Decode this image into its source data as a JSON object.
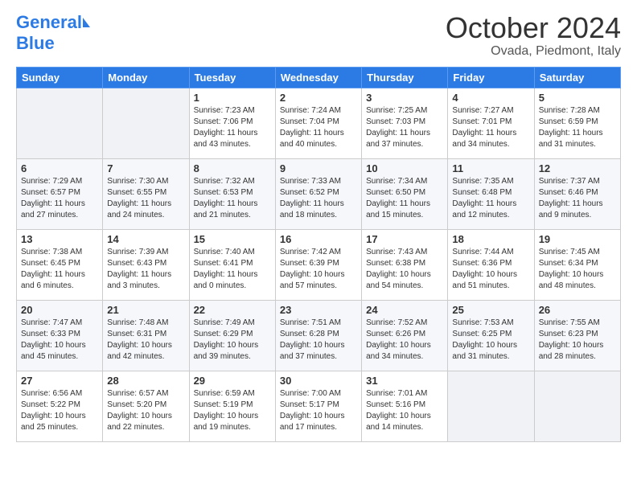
{
  "header": {
    "logo_line1": "General",
    "logo_line2": "Blue",
    "month": "October 2024",
    "location": "Ovada, Piedmont, Italy"
  },
  "days_of_week": [
    "Sunday",
    "Monday",
    "Tuesday",
    "Wednesday",
    "Thursday",
    "Friday",
    "Saturday"
  ],
  "weeks": [
    [
      {
        "day": "",
        "info": ""
      },
      {
        "day": "",
        "info": ""
      },
      {
        "day": "1",
        "info": "Sunrise: 7:23 AM\nSunset: 7:06 PM\nDaylight: 11 hours\nand 43 minutes."
      },
      {
        "day": "2",
        "info": "Sunrise: 7:24 AM\nSunset: 7:04 PM\nDaylight: 11 hours\nand 40 minutes."
      },
      {
        "day": "3",
        "info": "Sunrise: 7:25 AM\nSunset: 7:03 PM\nDaylight: 11 hours\nand 37 minutes."
      },
      {
        "day": "4",
        "info": "Sunrise: 7:27 AM\nSunset: 7:01 PM\nDaylight: 11 hours\nand 34 minutes."
      },
      {
        "day": "5",
        "info": "Sunrise: 7:28 AM\nSunset: 6:59 PM\nDaylight: 11 hours\nand 31 minutes."
      }
    ],
    [
      {
        "day": "6",
        "info": "Sunrise: 7:29 AM\nSunset: 6:57 PM\nDaylight: 11 hours\nand 27 minutes."
      },
      {
        "day": "7",
        "info": "Sunrise: 7:30 AM\nSunset: 6:55 PM\nDaylight: 11 hours\nand 24 minutes."
      },
      {
        "day": "8",
        "info": "Sunrise: 7:32 AM\nSunset: 6:53 PM\nDaylight: 11 hours\nand 21 minutes."
      },
      {
        "day": "9",
        "info": "Sunrise: 7:33 AM\nSunset: 6:52 PM\nDaylight: 11 hours\nand 18 minutes."
      },
      {
        "day": "10",
        "info": "Sunrise: 7:34 AM\nSunset: 6:50 PM\nDaylight: 11 hours\nand 15 minutes."
      },
      {
        "day": "11",
        "info": "Sunrise: 7:35 AM\nSunset: 6:48 PM\nDaylight: 11 hours\nand 12 minutes."
      },
      {
        "day": "12",
        "info": "Sunrise: 7:37 AM\nSunset: 6:46 PM\nDaylight: 11 hours\nand 9 minutes."
      }
    ],
    [
      {
        "day": "13",
        "info": "Sunrise: 7:38 AM\nSunset: 6:45 PM\nDaylight: 11 hours\nand 6 minutes."
      },
      {
        "day": "14",
        "info": "Sunrise: 7:39 AM\nSunset: 6:43 PM\nDaylight: 11 hours\nand 3 minutes."
      },
      {
        "day": "15",
        "info": "Sunrise: 7:40 AM\nSunset: 6:41 PM\nDaylight: 11 hours\nand 0 minutes."
      },
      {
        "day": "16",
        "info": "Sunrise: 7:42 AM\nSunset: 6:39 PM\nDaylight: 10 hours\nand 57 minutes."
      },
      {
        "day": "17",
        "info": "Sunrise: 7:43 AM\nSunset: 6:38 PM\nDaylight: 10 hours\nand 54 minutes."
      },
      {
        "day": "18",
        "info": "Sunrise: 7:44 AM\nSunset: 6:36 PM\nDaylight: 10 hours\nand 51 minutes."
      },
      {
        "day": "19",
        "info": "Sunrise: 7:45 AM\nSunset: 6:34 PM\nDaylight: 10 hours\nand 48 minutes."
      }
    ],
    [
      {
        "day": "20",
        "info": "Sunrise: 7:47 AM\nSunset: 6:33 PM\nDaylight: 10 hours\nand 45 minutes."
      },
      {
        "day": "21",
        "info": "Sunrise: 7:48 AM\nSunset: 6:31 PM\nDaylight: 10 hours\nand 42 minutes."
      },
      {
        "day": "22",
        "info": "Sunrise: 7:49 AM\nSunset: 6:29 PM\nDaylight: 10 hours\nand 39 minutes."
      },
      {
        "day": "23",
        "info": "Sunrise: 7:51 AM\nSunset: 6:28 PM\nDaylight: 10 hours\nand 37 minutes."
      },
      {
        "day": "24",
        "info": "Sunrise: 7:52 AM\nSunset: 6:26 PM\nDaylight: 10 hours\nand 34 minutes."
      },
      {
        "day": "25",
        "info": "Sunrise: 7:53 AM\nSunset: 6:25 PM\nDaylight: 10 hours\nand 31 minutes."
      },
      {
        "day": "26",
        "info": "Sunrise: 7:55 AM\nSunset: 6:23 PM\nDaylight: 10 hours\nand 28 minutes."
      }
    ],
    [
      {
        "day": "27",
        "info": "Sunrise: 6:56 AM\nSunset: 5:22 PM\nDaylight: 10 hours\nand 25 minutes."
      },
      {
        "day": "28",
        "info": "Sunrise: 6:57 AM\nSunset: 5:20 PM\nDaylight: 10 hours\nand 22 minutes."
      },
      {
        "day": "29",
        "info": "Sunrise: 6:59 AM\nSunset: 5:19 PM\nDaylight: 10 hours\nand 19 minutes."
      },
      {
        "day": "30",
        "info": "Sunrise: 7:00 AM\nSunset: 5:17 PM\nDaylight: 10 hours\nand 17 minutes."
      },
      {
        "day": "31",
        "info": "Sunrise: 7:01 AM\nSunset: 5:16 PM\nDaylight: 10 hours\nand 14 minutes."
      },
      {
        "day": "",
        "info": ""
      },
      {
        "day": "",
        "info": ""
      }
    ]
  ]
}
